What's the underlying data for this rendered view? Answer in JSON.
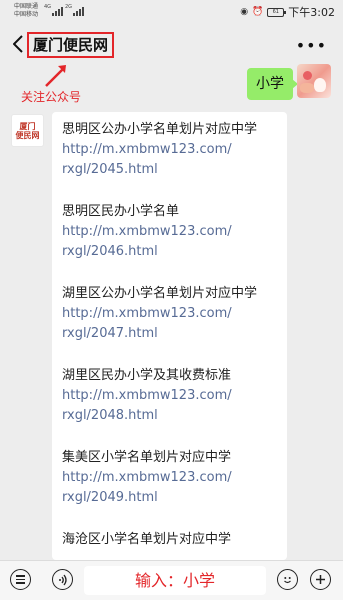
{
  "status_bar": {
    "carrier_1": "中国联通",
    "carrier_2": "中国移动",
    "net_1": "4G",
    "net_2": "2G",
    "battery": "61",
    "time": "下午3:02"
  },
  "header": {
    "back_icon": "chevron-left-icon",
    "title": "厦门便民网",
    "more_icon": "more-icon"
  },
  "annotation": {
    "text": "关注公众号",
    "color": "#e3262a"
  },
  "chat": {
    "user_message": "小学",
    "bot_avatar": {
      "line1": "厦门",
      "line2": "便民网"
    },
    "bot_entries": [
      {
        "name": "思明区公办小学名单划片对应中学",
        "link_1": "http://m.xmbmw123.com/",
        "link_2": "rxgl/2045.html"
      },
      {
        "name": "思明区民办小学名单",
        "link_1": "http://m.xmbmw123.com/",
        "link_2": "rxgl/2046.html"
      },
      {
        "name": "湖里区公办小学名单划片对应中学",
        "link_1": "http://m.xmbmw123.com/",
        "link_2": "rxgl/2047.html"
      },
      {
        "name": "湖里区民办小学及其收费标准",
        "link_1": "http://m.xmbmw123.com/",
        "link_2": "rxgl/2048.html"
      },
      {
        "name": "集美区小学名单划片对应中学",
        "link_1": "http://m.xmbmw123.com/",
        "link_2": "rxgl/2049.html"
      },
      {
        "name": "海沧区小学名单划片对应中学",
        "link_1": "",
        "link_2": ""
      }
    ]
  },
  "input_bar": {
    "input_text": "输入：小学",
    "icons": [
      "menu-icon",
      "voice-icon",
      "emoji-icon",
      "plus-icon"
    ]
  },
  "colors": {
    "background": "#ededed",
    "user_bubble": "#95ec69",
    "link": "#576b95",
    "highlight": "#e3262a"
  }
}
